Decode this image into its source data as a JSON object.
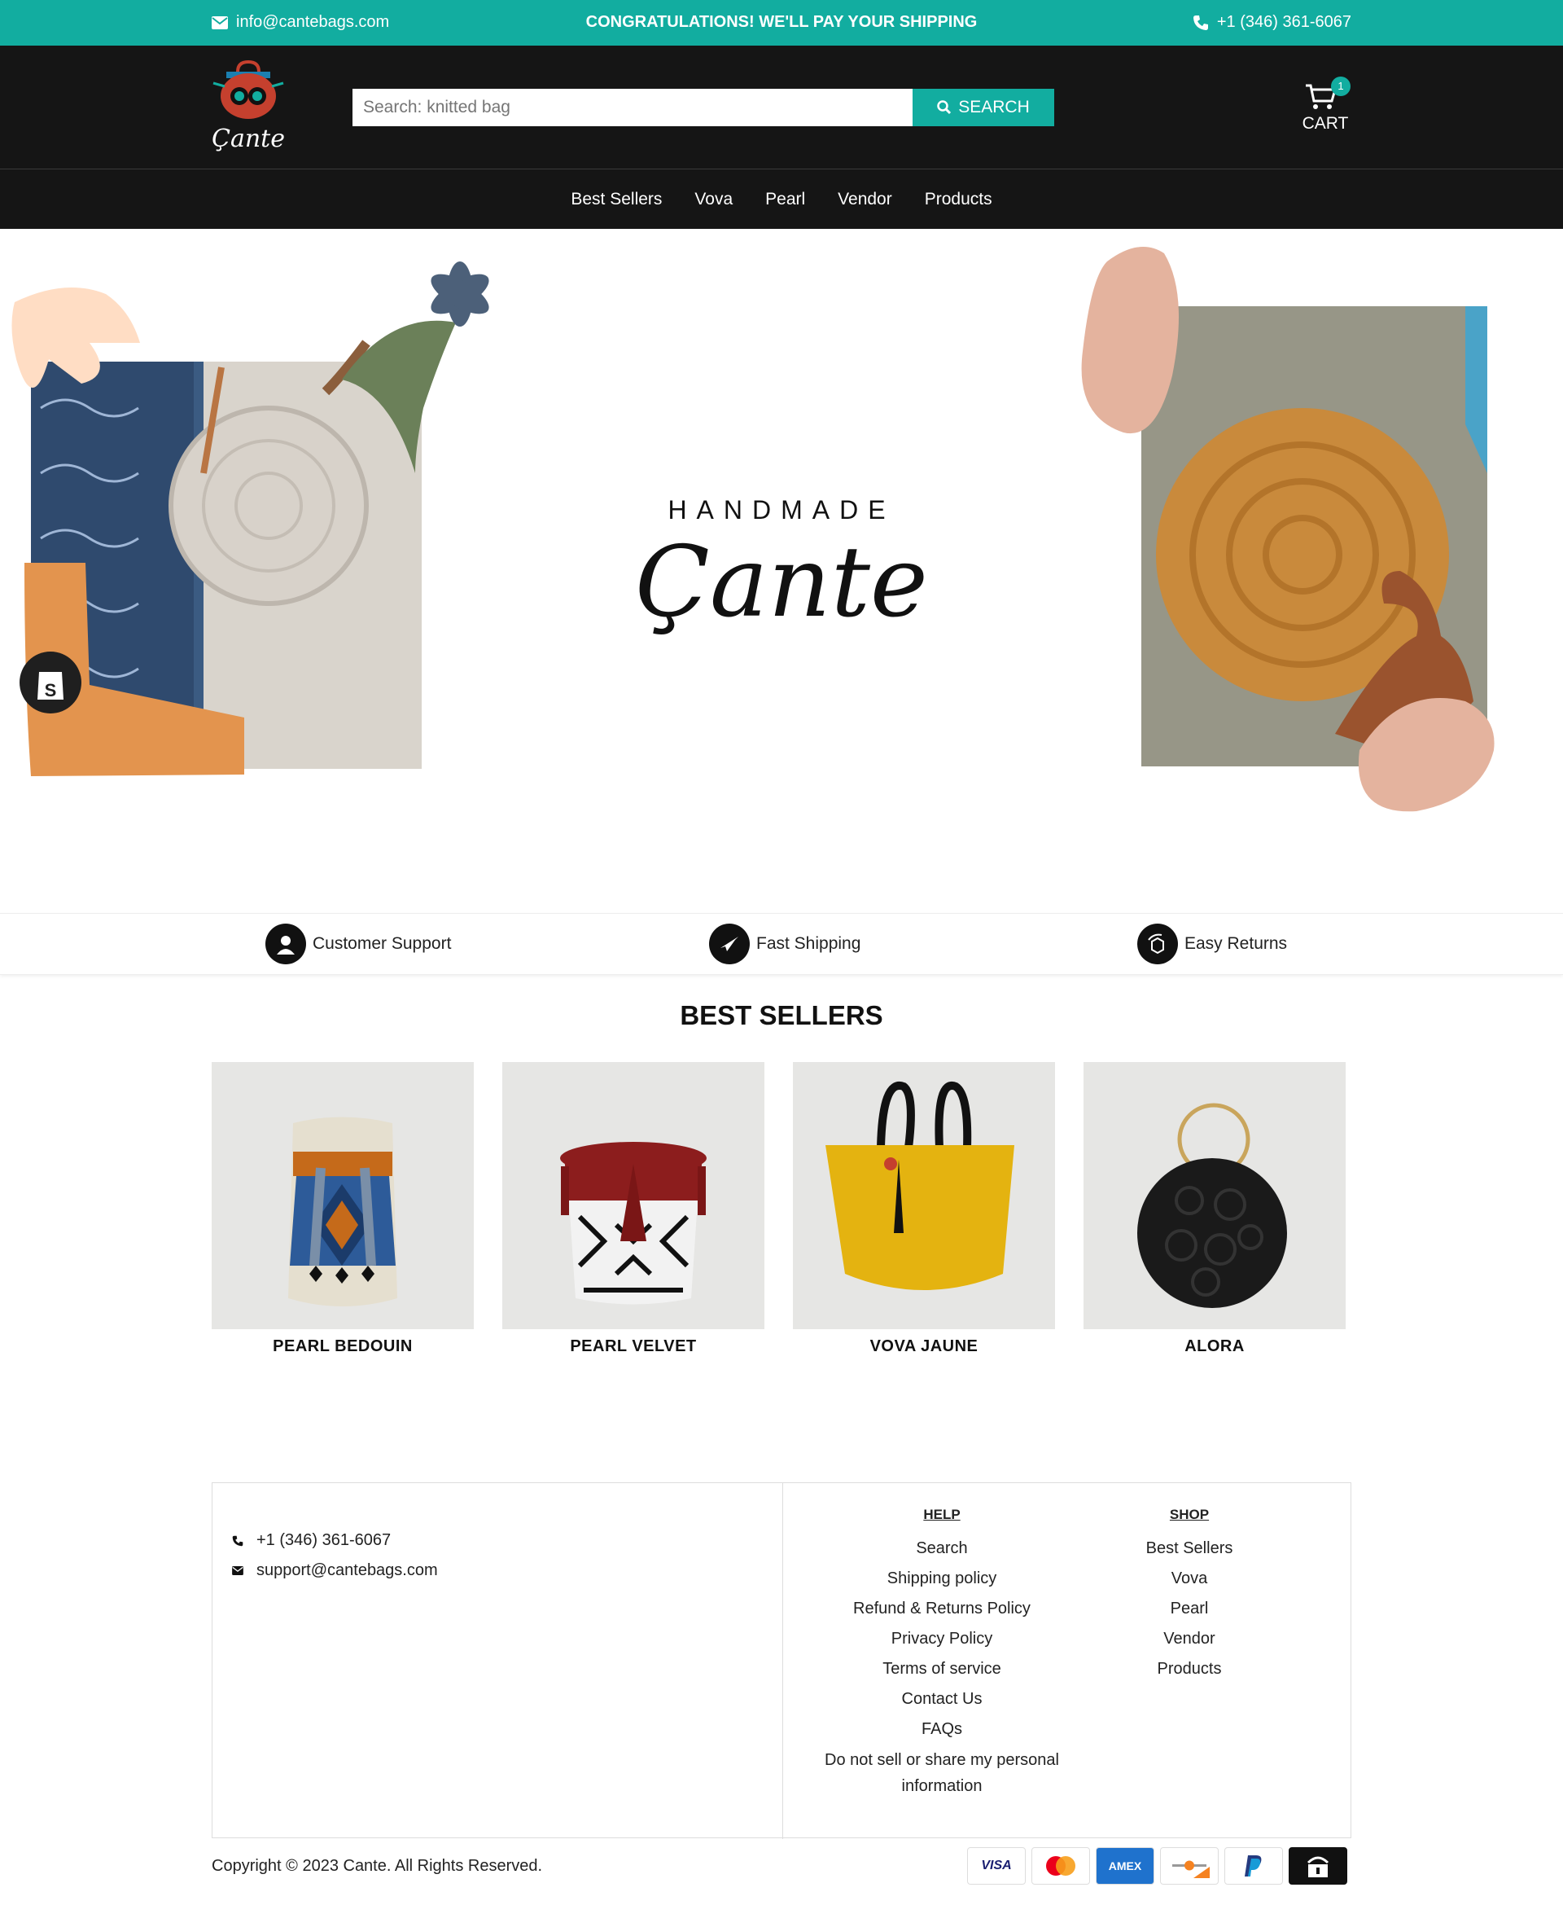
{
  "topbar": {
    "email": "info@cantebags.com",
    "promo": "CONGRATULATIONS! WE'LL PAY YOUR SHIPPING",
    "phone": "+1 (346) 361-6067"
  },
  "header": {
    "logo_text": "Çante",
    "search_placeholder": "Search: knitted bag",
    "search_button": "SEARCH",
    "cart_count": "1",
    "cart_label": "CART"
  },
  "nav": [
    "Best Sellers",
    "Vova",
    "Pearl",
    "Vendor",
    "Products"
  ],
  "hero": {
    "tagline": "HANDMADE",
    "brand": "Çante"
  },
  "features": [
    "Customer Support",
    "Fast Shipping",
    "Easy Returns"
  ],
  "best_sellers": {
    "title": "BEST SELLERS",
    "products": [
      "PEARL BEDOUIN",
      "PEARL VELVET",
      "VOVA JAUNE",
      "ALORA"
    ]
  },
  "footer": {
    "phone": "+1 (346) 361-6067",
    "email": "support@cantebags.com",
    "help_title": "HELP",
    "help_items": [
      "Search",
      "Shipping policy",
      "Refund & Returns Policy",
      "Privacy Policy",
      "Terms of service",
      "Contact Us",
      "FAQs",
      "Do not sell or share my personal information"
    ],
    "shop_title": "SHOP",
    "shop_items": [
      "Best Sellers",
      "Vova",
      "Pearl",
      "Vendor",
      "Products"
    ],
    "copyright": "Copyright © 2023 Cante. All Rights Reserved."
  },
  "payments": [
    "VISA",
    "Mastercard",
    "AMEX",
    "Discover",
    "PayPal",
    "Shop Pay"
  ],
  "colors": {
    "accent": "#12ada0",
    "dark": "#151515"
  }
}
